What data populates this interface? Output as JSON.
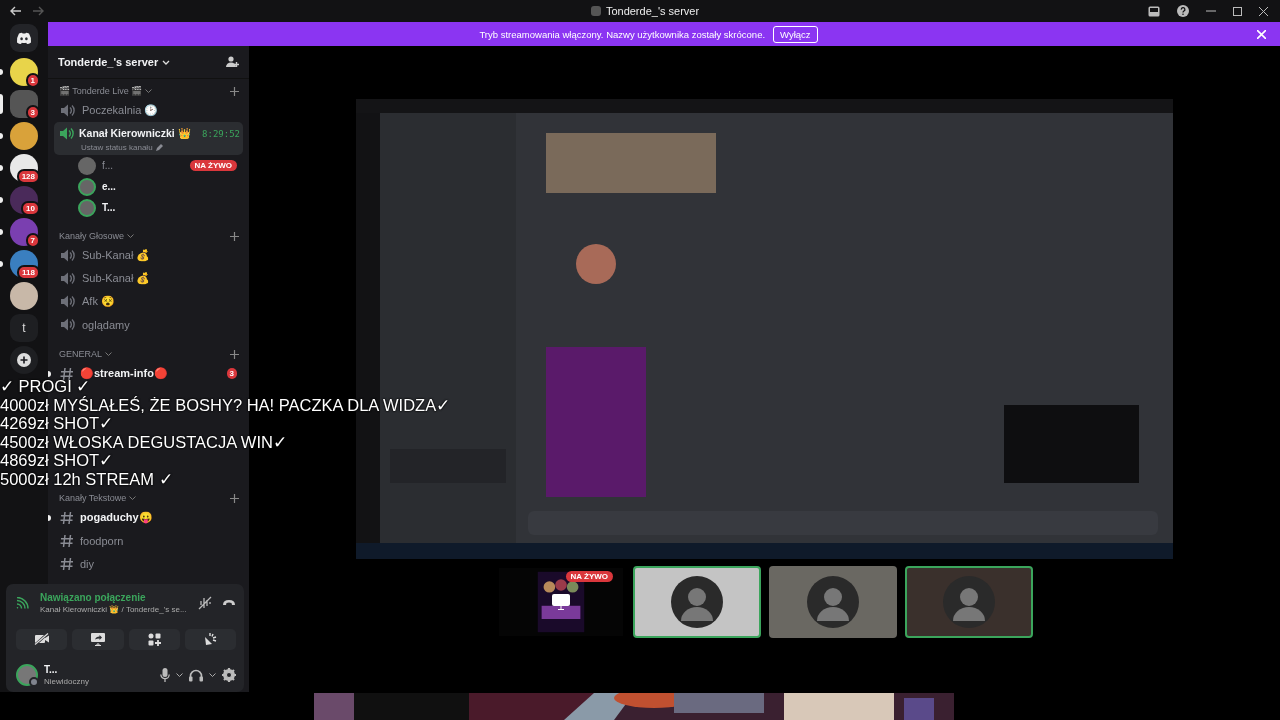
{
  "window": {
    "title": "Tonderde_'s server"
  },
  "banner": {
    "text": "Tryb streamowania włączony. Nazwy użytkownika zostały skrócone.",
    "button": "Wyłącz"
  },
  "servers": [
    {
      "badge": "1",
      "selected": false,
      "unread": true,
      "color": "#e8d44a"
    },
    {
      "badge": "3",
      "selected": true,
      "color": "#555555"
    },
    {
      "selected": false,
      "unread": true,
      "color": "#d9a23a"
    },
    {
      "badge": "128",
      "selected": false,
      "unread": true,
      "color": "#e8e8e8"
    },
    {
      "badge": "10",
      "selected": false,
      "unread": true,
      "color": "#4a2a5a"
    },
    {
      "badge": "7",
      "selected": false,
      "unread": true,
      "color": "#7a3fb0"
    },
    {
      "badge": "118",
      "selected": false,
      "unread": true,
      "color": "#3a7fc0"
    },
    {
      "selected": false,
      "unread": false,
      "color": "#c8b8a8"
    }
  ],
  "server_letter": "t",
  "server": {
    "name": "Tonderde_'s server"
  },
  "categories": [
    {
      "name": "🎬 Tonderde Live 🎬",
      "channels": [
        {
          "kind": "voice",
          "name": "Poczekalnia 🕑",
          "selected": false,
          "unread": false
        },
        {
          "kind": "voice",
          "name": "Kanał Kierowniczki 👑",
          "selected": true,
          "unread": true,
          "timer": "8:29:52",
          "status": "Ustaw status kanału",
          "users": [
            {
              "name": "f...",
              "live": true,
              "live_label": "NA ŻYWO",
              "speaking": false
            },
            {
              "name": "e...",
              "live": false,
              "speaking": true
            },
            {
              "name": "T...",
              "live": false,
              "speaking": true
            }
          ]
        }
      ]
    },
    {
      "name": "Kanały Głosowe",
      "channels": [
        {
          "kind": "voice",
          "name": "Sub-Kanał 💰",
          "selected": false,
          "unread": false
        },
        {
          "kind": "voice",
          "name": "Sub-Kanał 💰",
          "selected": false,
          "unread": false
        },
        {
          "kind": "voice",
          "name": "Afk 😵",
          "selected": false,
          "unread": false
        },
        {
          "kind": "voice",
          "name": "oglądamy",
          "selected": false,
          "unread": false
        }
      ]
    },
    {
      "name": "GENERAL",
      "channels": [
        {
          "kind": "text",
          "name": "🔴stream-info🔴",
          "selected": false,
          "unread": true,
          "badge": "3"
        }
      ]
    },
    {
      "name": "Kanały Tekstowe",
      "channels": [
        {
          "kind": "text",
          "name": "pogaduchy😛",
          "selected": false,
          "unread": true
        },
        {
          "kind": "text",
          "name": "foodporn",
          "selected": false,
          "unread": false
        },
        {
          "kind": "text",
          "name": "diy",
          "selected": false,
          "unread": false
        }
      ]
    }
  ],
  "overlay_lines": [
    "✓ PROGI ✓",
    "4000zł MYŚLAŁEŚ, ŻE BOSHY? HA! PACZKA DLA WIDZA✓",
    "4269zł SHOT✓",
    "4500zł WŁOSKA DEGUSTACJA WIN✓",
    "4869zł SHOT✓",
    "5000zł 12h STREAM ✓"
  ],
  "voice_panel": {
    "status": "Nawiązano połączenie",
    "channel": "Kanał Kierowniczki 👑 / Tonderde_'s se..."
  },
  "user": {
    "name": "T...",
    "status": "Niewidoczny"
  },
  "participants": [
    {
      "kind": "stream",
      "live_label": "NA ŻYWO",
      "speaking": false,
      "color": "#1a0a2a"
    },
    {
      "kind": "user",
      "speaking": true,
      "color": "#c4c4c4"
    },
    {
      "kind": "user",
      "speaking": false,
      "color": "#6a6862"
    },
    {
      "kind": "user",
      "speaking": true,
      "color": "#3a302c"
    }
  ]
}
